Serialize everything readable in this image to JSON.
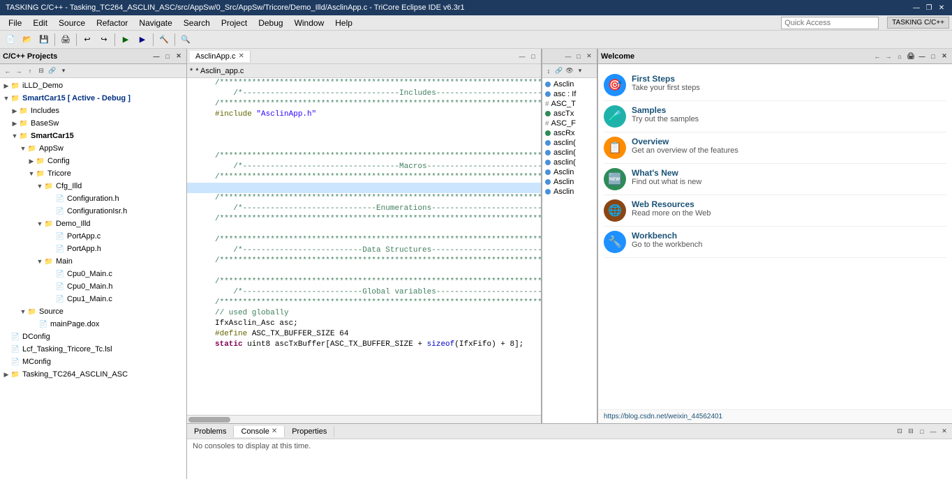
{
  "titleBar": {
    "title": "TASKING C/C++ - Tasking_TC264_ASCLIN_ASC/src/AppSw/0_Src/AppSw/Tricore/Demo_Illd/AsclinApp.c - TriCore Eclipse IDE v6.3r1",
    "minimize": "—",
    "maximize": "❐",
    "close": "✕"
  },
  "menuBar": {
    "items": [
      "File",
      "Edit",
      "Source",
      "Refactor",
      "Navigate",
      "Search",
      "Project",
      "Debug",
      "Window",
      "Help"
    ]
  },
  "quickAccess": {
    "label": "Quick Access",
    "placeholder": "Quick Access"
  },
  "leftPanel": {
    "title": "C/C++ Projects",
    "tree": [
      {
        "id": "illd-demo",
        "label": "iLLD_Demo",
        "level": 0,
        "type": "folder",
        "expanded": false
      },
      {
        "id": "smartcar15",
        "label": "SmartCar15 [ Active - Debug ]",
        "level": 0,
        "type": "folder",
        "expanded": true,
        "active": true
      },
      {
        "id": "includes",
        "label": "Includes",
        "level": 1,
        "type": "folder",
        "expanded": false
      },
      {
        "id": "basesw",
        "label": "BaseSw",
        "level": 1,
        "type": "folder",
        "expanded": false
      },
      {
        "id": "smartcar15-2",
        "label": "SmartCar15",
        "level": 1,
        "type": "folder",
        "expanded": true
      },
      {
        "id": "appsw",
        "label": "AppSw",
        "level": 2,
        "type": "folder",
        "expanded": true
      },
      {
        "id": "config",
        "label": "Config",
        "level": 3,
        "type": "folder",
        "expanded": false
      },
      {
        "id": "tricore",
        "label": "Tricore",
        "level": 3,
        "type": "folder",
        "expanded": true
      },
      {
        "id": "cfg-illd",
        "label": "Cfg_Illd",
        "level": 4,
        "type": "folder",
        "expanded": true
      },
      {
        "id": "configuration-h",
        "label": "Configuration.h",
        "level": 5,
        "type": "file"
      },
      {
        "id": "configurationisr-h",
        "label": "ConfigurationIsr.h",
        "level": 5,
        "type": "file"
      },
      {
        "id": "demo-illd",
        "label": "Demo_Illd",
        "level": 4,
        "type": "folder",
        "expanded": true
      },
      {
        "id": "portapp-c",
        "label": "PortApp.c",
        "level": 5,
        "type": "file"
      },
      {
        "id": "portapp-h",
        "label": "PortApp.h",
        "level": 5,
        "type": "file"
      },
      {
        "id": "main",
        "label": "Main",
        "level": 4,
        "type": "folder",
        "expanded": true
      },
      {
        "id": "cpu0-main-c",
        "label": "Cpu0_Main.c",
        "level": 5,
        "type": "file"
      },
      {
        "id": "cpu0-main-h",
        "label": "Cpu0_Main.h",
        "level": 5,
        "type": "file"
      },
      {
        "id": "cpu1-main-c",
        "label": "Cpu1_Main.c",
        "level": 5,
        "type": "file"
      },
      {
        "id": "source",
        "label": "Source",
        "level": 2,
        "type": "folder",
        "expanded": true
      },
      {
        "id": "mainpage-dox",
        "label": "mainPage.dox",
        "level": 3,
        "type": "file"
      },
      {
        "id": "dconfig",
        "label": "DConfig",
        "level": 0,
        "type": "file"
      },
      {
        "id": "lcf-tasking",
        "label": "Lcf_Tasking_Tricore_Tc.lsl",
        "level": 0,
        "type": "file"
      },
      {
        "id": "mconfig",
        "label": "MConfig",
        "level": 0,
        "type": "file"
      },
      {
        "id": "tasking-tc264",
        "label": "Tasking_TC264_ASCLIN_ASC",
        "level": 0,
        "type": "folder",
        "expanded": false
      }
    ]
  },
  "editor": {
    "tab": "AsclinApp.c",
    "breadcrumb": "* Asclin_app.c",
    "lines": [
      {
        "num": "",
        "content": "/*************************************************************************************/",
        "type": "comment"
      },
      {
        "num": "",
        "content": "/*----------------------------------Includes-----------------------------------*/",
        "type": "comment"
      },
      {
        "num": "",
        "content": "/*************************************************************************************/",
        "type": "comment"
      },
      {
        "num": "",
        "content": "#include \"AsclinApp.h\"",
        "type": "include"
      },
      {
        "num": "",
        "content": "",
        "type": "blank"
      },
      {
        "num": "",
        "content": "",
        "type": "blank"
      },
      {
        "num": "",
        "content": "",
        "type": "blank"
      },
      {
        "num": "",
        "content": "/*************************************************************************************/",
        "type": "comment"
      },
      {
        "num": "",
        "content": "/*----------------------------------Macros------------------------------------*/",
        "type": "comment"
      },
      {
        "num": "",
        "content": "/*************************************************************************************/",
        "type": "comment"
      },
      {
        "num": "",
        "content": "",
        "type": "blank",
        "highlighted": true
      },
      {
        "num": "",
        "content": "/*************************************************************************************/",
        "type": "comment"
      },
      {
        "num": "",
        "content": "/*-----------------------------Enumerations-----------------------------------*/",
        "type": "comment"
      },
      {
        "num": "",
        "content": "/*************************************************************************************/",
        "type": "comment"
      },
      {
        "num": "",
        "content": "",
        "type": "blank"
      },
      {
        "num": "",
        "content": "/*************************************************************************************/",
        "type": "comment"
      },
      {
        "num": "",
        "content": "/*--------------------------Data Structures-----------------------------------*/",
        "type": "comment"
      },
      {
        "num": "",
        "content": "/*************************************************************************************/",
        "type": "comment"
      },
      {
        "num": "",
        "content": "",
        "type": "blank"
      },
      {
        "num": "",
        "content": "/*************************************************************************************/",
        "type": "comment"
      },
      {
        "num": "",
        "content": "/*--------------------------Global variables----------------------------------*/",
        "type": "comment"
      },
      {
        "num": "",
        "content": "/*************************************************************************************/",
        "type": "comment"
      },
      {
        "num": "",
        "content": "// used globally",
        "type": "linecomment"
      },
      {
        "num": "",
        "content": "IfxAsclin_Asc asc;",
        "type": "code"
      },
      {
        "num": "",
        "content": "#define ASC_TX_BUFFER_SIZE 64",
        "type": "define"
      },
      {
        "num": "",
        "content": "static uint8 ascTxBuffer[ASC_TX_BUFFER_SIZE + sizeof(IfxFifo) + 8];",
        "type": "code"
      }
    ]
  },
  "outline": {
    "title": "",
    "items": [
      {
        "label": "Asclin",
        "type": "blue"
      },
      {
        "label": "asc : If",
        "type": "teal"
      },
      {
        "label": "# ASC_T",
        "type": "orange"
      },
      {
        "label": "● ascTx",
        "type": "green"
      },
      {
        "label": "# ASC_F",
        "type": "orange"
      },
      {
        "label": "● ascRx",
        "type": "green"
      },
      {
        "label": "asclin(",
        "type": "blue"
      },
      {
        "label": "asclin(",
        "type": "blue"
      },
      {
        "label": "asclin(",
        "type": "blue"
      },
      {
        "label": "Asclin",
        "type": "blue"
      },
      {
        "label": "Asclin",
        "type": "blue"
      },
      {
        "label": "Asclin",
        "type": "blue"
      }
    ]
  },
  "welcome": {
    "title": "Welcome",
    "items": [
      {
        "icon": "🎯",
        "iconColor": "wi-blue",
        "title": "First Steps",
        "desc": "Take your first steps"
      },
      {
        "icon": "🧪",
        "iconColor": "wi-teal",
        "title": "Samples",
        "desc": "Try out the samples"
      },
      {
        "icon": "📋",
        "iconColor": "wi-orange",
        "title": "Overview",
        "desc": "Get an overview of the features"
      },
      {
        "icon": "🆕",
        "iconColor": "wi-green",
        "title": "What's New",
        "desc": "Find out what is new"
      },
      {
        "icon": "🌐",
        "iconColor": "wi-purple",
        "title": "Web Resources",
        "desc": "Read more on the Web"
      },
      {
        "icon": "🔧",
        "iconColor": "wi-blue",
        "title": "Workbench",
        "desc": "Go to the workbench"
      }
    ],
    "footer": "https://blog.csdn.net/weixin_44562401"
  },
  "bottomPanel": {
    "tabs": [
      "Problems",
      "Console",
      "Properties"
    ],
    "activeTab": "Console",
    "content": "No consoles to display at this time."
  },
  "perspective": "TASKING C/C++"
}
